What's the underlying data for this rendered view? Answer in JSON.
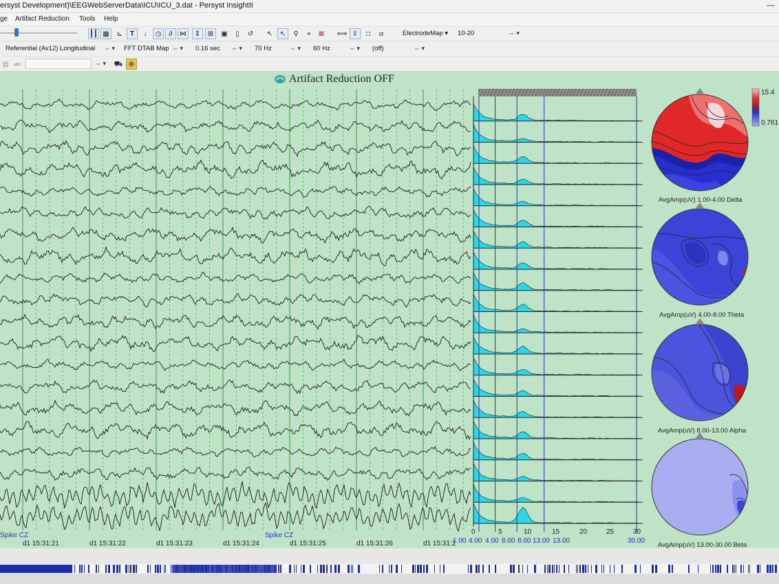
{
  "window": {
    "title": "ersyst Development)\\EEGWebServerData\\ICU\\ICU_3.dat - Persyst InsightII"
  },
  "menu": [
    "ge",
    "Artifact Reduction",
    "Tools",
    "Help"
  ],
  "toolbar": {
    "electrode_map_label": "ElectrodeMap",
    "electrode_system": "10-20",
    "montage": "Referential (Av12) Longitudinal",
    "fft_mode": "FFT DTAB Map",
    "time_constant": "0.16 sec",
    "high_filter": "70 Hz",
    "notch_filter": "60 Hz",
    "filter_extra": "(off)",
    "search_value": ""
  },
  "artifact": {
    "title": "Artifact Reduction OFF"
  },
  "eeg": {
    "channel_count": 20,
    "spike_labels": [
      "Spike CZ",
      "Spike CZ"
    ],
    "timestamps": [
      "d1 15:31:21",
      "d1 15:31:22",
      "d1 15:31:23",
      "d1 15:31:24",
      "d1 15:31:25",
      "d1 15:31:26",
      "d1 15:31:2"
    ]
  },
  "fft": {
    "axis_ticks": [
      "0",
      "5",
      "10",
      "15",
      "20",
      "25",
      "30"
    ],
    "band_labels": [
      "1.00",
      "4.00",
      "4.00",
      "8.00",
      "8.00",
      "13.00",
      "13.00",
      "30.00"
    ]
  },
  "topomaps": [
    {
      "label": "AvgAmp(uV) 1.00-4.00 Delta"
    },
    {
      "label": "AvgAmp(uV) 4.00-8.00 Theta"
    },
    {
      "label": "AvgAmp(uV) 8.00-13.00 Alpha"
    },
    {
      "label": "AvgAmp(uV) 13.00-30.00 Beta"
    }
  ],
  "colorbar": {
    "max": "15.4",
    "min": "0.761"
  },
  "colors": {
    "background": "#bfe3c7",
    "fft_fill": "#2ad8e6",
    "grid": "#3a9c3a",
    "band_line": "#2233bb",
    "hot": "#d01818",
    "cold": "#1d2fd0"
  }
}
